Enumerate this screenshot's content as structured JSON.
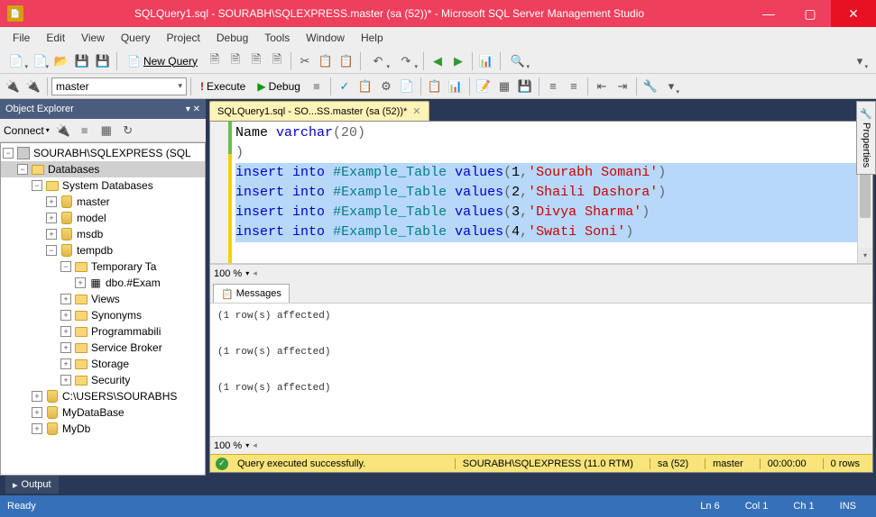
{
  "titlebar": {
    "title": "SQLQuery1.sql - SOURABH\\SQLEXPRESS.master (sa (52))* - Microsoft SQL Server Management Studio"
  },
  "menubar": [
    "File",
    "Edit",
    "View",
    "Query",
    "Project",
    "Debug",
    "Tools",
    "Window",
    "Help"
  ],
  "toolbar": {
    "new_query": "New Query"
  },
  "toolbar2": {
    "db": "master",
    "execute": "Execute",
    "debug": "Debug"
  },
  "object_explorer": {
    "title": "Object Explorer",
    "connect": "Connect",
    "tree": {
      "server": "SOURABH\\SQLEXPRESS (SQL",
      "databases": "Databases",
      "system_databases": "System Databases",
      "master": "master",
      "model": "model",
      "msdb": "msdb",
      "tempdb": "tempdb",
      "temporary_tables": "Temporary Ta",
      "dbo_exam": "dbo.#Exam",
      "views": "Views",
      "synonyms": "Synonyms",
      "programmability": "Programmabili",
      "service_broker": "Service Broker",
      "storage": "Storage",
      "security": "Security",
      "cusers": "C:\\USERS\\SOURABHS",
      "mydatabase": "MyDataBase",
      "mydb": "MyDb"
    }
  },
  "editor": {
    "tab": "SQLQuery1.sql - SO...SS.master (sa (52))*",
    "line1_a": "Name ",
    "line1_b": "varchar",
    "line1_c": "(20)",
    "line2": ")",
    "insert": "insert",
    "into": "into",
    "tbl": "#Example_Table",
    "values": "values",
    "v1": "1",
    "v2": "2",
    "v3": "3",
    "v4": "4",
    "s1": "'Sourabh Somani'",
    "s2": "'Shaili Dashora'",
    "s3": "'Divya Sharma'",
    "s4": "'Swati Soni'",
    "zoom": "100 %"
  },
  "messages": {
    "tab": "Messages",
    "row": "(1 row(s) affected)",
    "zoom": "100 %"
  },
  "status_yellow": {
    "msg": "Query executed successfully.",
    "server": "SOURABH\\SQLEXPRESS (11.0 RTM)",
    "user": "sa (52)",
    "db": "master",
    "time": "00:00:00",
    "rows": "0 rows"
  },
  "output_tab": "Output",
  "bottom_status": {
    "ready": "Ready",
    "ln": "Ln 6",
    "col": "Col 1",
    "ch": "Ch 1",
    "ins": "INS"
  },
  "properties": "Properties"
}
